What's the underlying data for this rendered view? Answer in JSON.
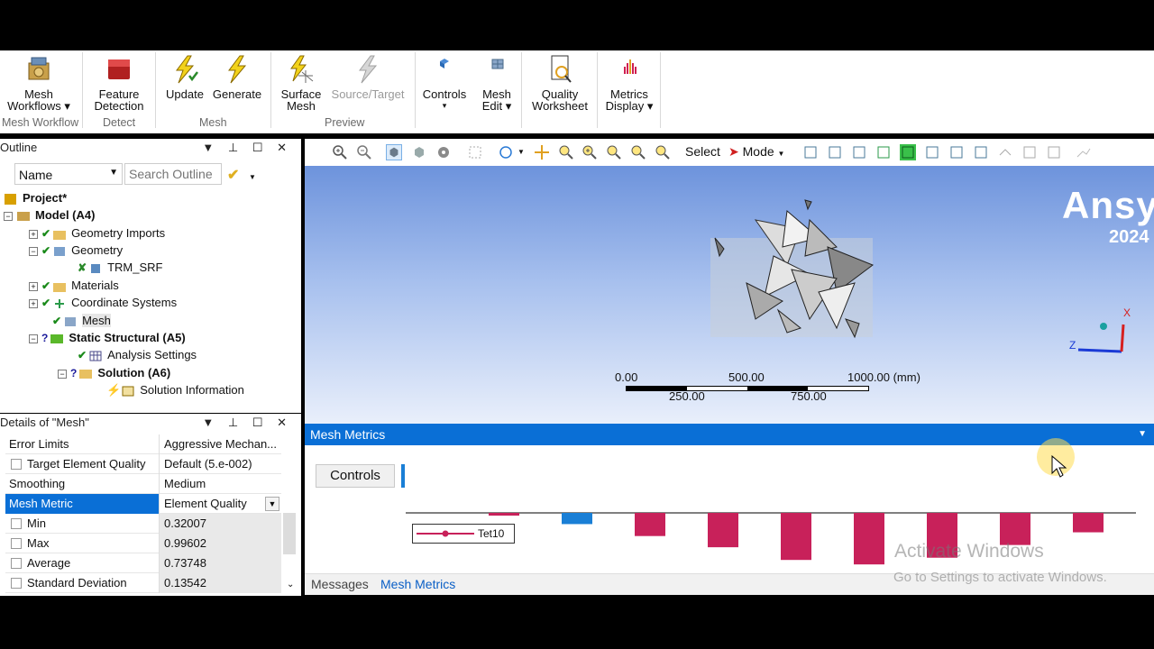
{
  "ribbon": {
    "buttons": [
      {
        "id": "mesh-workflows",
        "line1": "Mesh",
        "line2": "Workflows ▾"
      },
      {
        "id": "feature-detection",
        "line1": "Feature",
        "line2": "Detection"
      },
      {
        "id": "update",
        "line1": "Update",
        "line2": ""
      },
      {
        "id": "generate",
        "line1": "Generate",
        "line2": ""
      },
      {
        "id": "surface-mesh",
        "line1": "Surface",
        "line2": "Mesh"
      },
      {
        "id": "source-target",
        "line1": "Source/Target",
        "line2": ""
      },
      {
        "id": "controls",
        "line1": "Controls",
        "line2": "▾"
      },
      {
        "id": "mesh-edit",
        "line1": "Mesh",
        "line2": "Edit ▾"
      },
      {
        "id": "quality-worksheet",
        "line1": "Quality",
        "line2": "Worksheet"
      },
      {
        "id": "metrics-display",
        "line1": "Metrics",
        "line2": "Display ▾"
      }
    ],
    "groups": [
      "Mesh Workflow",
      "Detect",
      "Mesh",
      "Preview"
    ]
  },
  "outline": {
    "title": "Outline",
    "filter_label": "Name",
    "search_placeholder": "Search Outline",
    "tree": [
      "Project*",
      "Model (A4)",
      "Geometry Imports",
      "Geometry",
      "TRM_SRF",
      "Materials",
      "Coordinate Systems",
      "Mesh",
      "Static Structural (A5)",
      "Analysis Settings",
      "Solution (A6)",
      "Solution Information"
    ]
  },
  "details": {
    "title": "Details of \"Mesh\"",
    "rows": [
      {
        "k": "Error Limits",
        "v": "Aggressive Mechan..."
      },
      {
        "k": "Target Element Quality",
        "v": "Default (5.e-002)"
      },
      {
        "k": "Smoothing",
        "v": "Medium"
      },
      {
        "k": "Mesh Metric",
        "v": "Element Quality"
      },
      {
        "k": "Min",
        "v": "0.32007"
      },
      {
        "k": "Max",
        "v": "0.99602"
      },
      {
        "k": "Average",
        "v": "0.73748"
      },
      {
        "k": "Standard Deviation",
        "v": "0.13542"
      }
    ]
  },
  "toolbar": {
    "select_label": "Select",
    "mode_label": "Mode"
  },
  "viewport": {
    "brand": "Ansy",
    "year": "2024",
    "scale_top": [
      "0.00",
      "500.00",
      "1000.00 (mm)"
    ],
    "scale_bottom": [
      "250.00",
      "750.00"
    ],
    "axis_x": "X",
    "axis_z": "Z"
  },
  "mesh_metrics": {
    "title": "Mesh Metrics",
    "controls_label": "Controls",
    "legend": "Tet10",
    "accent": "#c8215a",
    "blue": "#1a7fd6"
  },
  "chart_data": {
    "type": "bar",
    "series": [
      {
        "name": "Tet10",
        "values": [
          0.2,
          1.5,
          3.1,
          4.6,
          6.3,
          6.9,
          6.0,
          4.3,
          2.6
        ]
      }
    ],
    "highlight_index": 1,
    "xlabel": "",
    "ylabel": ""
  },
  "tabs": [
    "Messages",
    "Mesh Metrics"
  ],
  "watermark": {
    "line1": "Activate Windows",
    "line2": "Go to Settings to activate Windows."
  }
}
